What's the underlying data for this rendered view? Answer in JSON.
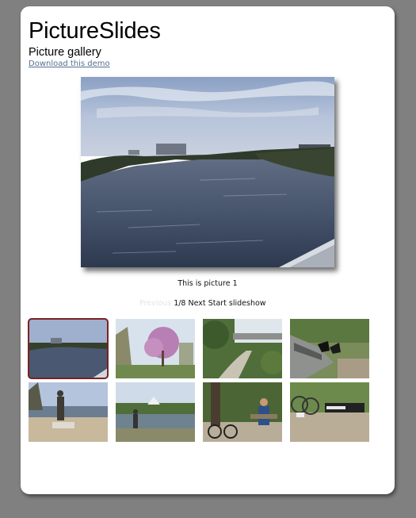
{
  "header": {
    "title": "PictureSlides",
    "subtitle": "Picture gallery",
    "download_link": "Download this demo"
  },
  "slideshow": {
    "caption": "This is picture 1",
    "prev_label": "Previous",
    "counter": "1/8",
    "next_label": "Next",
    "start_label": "Start slideshow",
    "current_index": 1,
    "total": 8
  },
  "thumbnails": [
    {
      "subject": "river-view",
      "selected": true
    },
    {
      "subject": "blossom-tree",
      "selected": false
    },
    {
      "subject": "bridge-path",
      "selected": false
    },
    {
      "subject": "bench-boots",
      "selected": false
    },
    {
      "subject": "statue-lake",
      "selected": false
    },
    {
      "subject": "fountain-park",
      "selected": false
    },
    {
      "subject": "cyclist-bench",
      "selected": false
    },
    {
      "subject": "bike-rack",
      "selected": false
    }
  ],
  "colors": {
    "page_background": "#808080",
    "card_background": "#ffffff",
    "link": "#53718f",
    "selected_border": "#7a2222",
    "disabled_nav": "#e4e4e4"
  }
}
